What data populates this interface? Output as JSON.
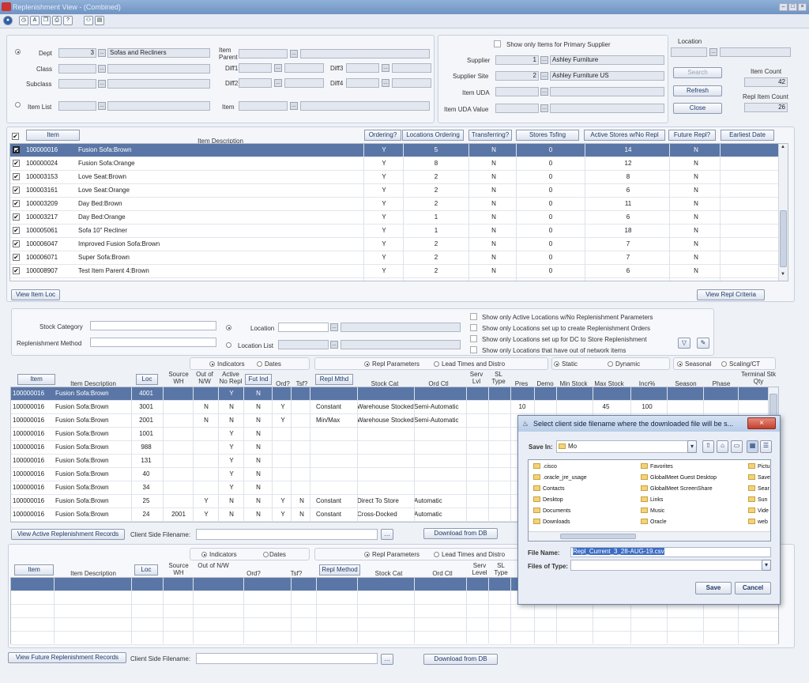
{
  "window": {
    "title": "Replenishment View - (Combined)"
  },
  "filter": {
    "dept_label": "Dept",
    "dept_value": "3",
    "dept_desc": "Sofas and Recliners",
    "class_label": "Class",
    "subclass_label": "Subclass",
    "item_list_label": "Item List",
    "item_parent_label": "Item Parent",
    "diff1_label": "Diff1",
    "diff2_label": "Diff2",
    "diff3_label": "Diff3",
    "diff4_label": "Diff4",
    "item_label": "Item",
    "primary_supplier_label": "Show only Items for Primary Supplier",
    "supplier_label": "Supplier",
    "supplier_value": "1",
    "supplier_desc": "Ashley Furniture",
    "supplier_site_label": "Supplier Site",
    "supplier_site_value": "2",
    "supplier_site_desc": "Ashley Furniture US",
    "item_uda_label": "Item UDA",
    "item_uda_value_label": "Item UDA Value",
    "location_label": "Location",
    "search_btn": "Search",
    "refresh_btn": "Refresh",
    "close_btn": "Close",
    "item_count_label": "Item Count",
    "item_count": "42",
    "repl_item_count_label": "Repl Item Count",
    "repl_item_count": "26"
  },
  "items_grid": {
    "headers": {
      "item": "Item",
      "desc": "Item Description",
      "ordering": "Ordering?",
      "locs_ordering": "Locations Ordering",
      "transferring": "Transferring?",
      "stores_tsfing": "Stores Tsfing",
      "active_stores": "Active Stores w/No Repl",
      "future_repl": "Future Repl?",
      "earliest_date": "Earliest Date"
    },
    "rows": [
      {
        "item": "100000016",
        "desc": "Fusion Sofa:Brown",
        "ordering": "Y",
        "locs": "5",
        "tsf": "N",
        "stores": "0",
        "active": "14",
        "future": "N"
      },
      {
        "item": "100000024",
        "desc": "Fusion Sofa:Orange",
        "ordering": "Y",
        "locs": "8",
        "tsf": "N",
        "stores": "0",
        "active": "12",
        "future": "N"
      },
      {
        "item": "100003153",
        "desc": "Love Seat:Brown",
        "ordering": "Y",
        "locs": "2",
        "tsf": "N",
        "stores": "0",
        "active": "8",
        "future": "N"
      },
      {
        "item": "100003161",
        "desc": "Love Seat:Orange",
        "ordering": "Y",
        "locs": "2",
        "tsf": "N",
        "stores": "0",
        "active": "6",
        "future": "N"
      },
      {
        "item": "100003209",
        "desc": "Day Bed:Brown",
        "ordering": "Y",
        "locs": "2",
        "tsf": "N",
        "stores": "0",
        "active": "11",
        "future": "N"
      },
      {
        "item": "100003217",
        "desc": "Day Bed:Orange",
        "ordering": "Y",
        "locs": "1",
        "tsf": "N",
        "stores": "0",
        "active": "6",
        "future": "N"
      },
      {
        "item": "100005061",
        "desc": "Sofa 10\" Recliner",
        "ordering": "Y",
        "locs": "1",
        "tsf": "N",
        "stores": "0",
        "active": "18",
        "future": "N"
      },
      {
        "item": "100006047",
        "desc": "Improved Fusion Sofa:Brown",
        "ordering": "Y",
        "locs": "2",
        "tsf": "N",
        "stores": "0",
        "active": "7",
        "future": "N"
      },
      {
        "item": "100006071",
        "desc": "Super Sofa:Brown",
        "ordering": "Y",
        "locs": "2",
        "tsf": "N",
        "stores": "0",
        "active": "7",
        "future": "N"
      },
      {
        "item": "100008907",
        "desc": "Test Item Parent 4:Brown",
        "ordering": "Y",
        "locs": "2",
        "tsf": "N",
        "stores": "0",
        "active": "6",
        "future": "N"
      }
    ]
  },
  "view_item_loc_btn": "View Item Loc",
  "view_repl_criteria_btn": "View Repl Criteria",
  "loc_filter": {
    "stock_category_label": "Stock Category",
    "repl_method_label": "Replenishment Method",
    "location_label": "Location",
    "location_list_label": "Location List",
    "opt1": "Show only Active Locations w/No Replenishment Parameters",
    "opt2": "Show only Locations set up to create Replenishment Orders",
    "opt3": "Show only Locations set up for DC to Store Replenishment",
    "opt4": "Show only Locations that have out of network items"
  },
  "active_grid": {
    "radio_indicators": "Indicators",
    "radio_dates": "Dates",
    "radio_repl_params": "Repl Parameters",
    "radio_lead_times": "Lead Times and Distro",
    "radio_static": "Static",
    "radio_dynamic": "Dynamic",
    "radio_seasonal": "Seasonal",
    "radio_scaling": "Scaling/CT",
    "headers": {
      "item": "Item",
      "desc": "Item Description",
      "loc": "Loc",
      "source_wh": "Source WH",
      "out_of_nw": "Out of N/W",
      "active_no_repl": "Active No Repl",
      "fut_ind": "Fut Ind",
      "ord": "Ord?",
      "tsf": "Tsf?",
      "repl_mthd": "Repl Mthd",
      "stock_cat": "Stock Cat",
      "ord_ctl": "Ord Ctl",
      "serv_lvl": "Serv Lvl",
      "sl_type": "SL Type",
      "pres": "Pres",
      "demo": "Demo",
      "min_stock": "Min Stock",
      "max_stock": "Max Stock",
      "incr": "Incr%",
      "season": "Season",
      "phase": "Phase",
      "terminal_stk": "Terminal Stk Qty"
    },
    "rows": [
      {
        "item": "100000016",
        "desc": "Fusion Sofa:Brown",
        "loc": "4001",
        "src": "",
        "onw": "",
        "anr": "Y",
        "fut": "N",
        "ord": "",
        "tsf": "",
        "mthd": "",
        "cat": "",
        "ctl": "",
        "pres": "",
        "max": "",
        "incr": ""
      },
      {
        "item": "100000016",
        "desc": "Fusion Sofa:Brown",
        "loc": "3001",
        "src": "",
        "onw": "N",
        "anr": "N",
        "fut": "N",
        "ord": "Y",
        "tsf": "",
        "mthd": "Constant",
        "cat": "Warehouse Stocked",
        "ctl": "Semi-Automatic",
        "pres": "10",
        "max": "45",
        "incr": "100"
      },
      {
        "item": "100000016",
        "desc": "Fusion Sofa:Brown",
        "loc": "2001",
        "src": "",
        "onw": "N",
        "anr": "N",
        "fut": "N",
        "ord": "Y",
        "tsf": "",
        "mthd": "Min/Max",
        "cat": "Warehouse Stocked",
        "ctl": "Semi-Automatic",
        "pres": "",
        "max": "",
        "incr": ""
      },
      {
        "item": "100000016",
        "desc": "Fusion Sofa:Brown",
        "loc": "1001",
        "src": "",
        "onw": "",
        "anr": "Y",
        "fut": "N",
        "ord": "",
        "tsf": "",
        "mthd": "",
        "cat": "",
        "ctl": "",
        "pres": "",
        "max": "",
        "incr": ""
      },
      {
        "item": "100000016",
        "desc": "Fusion Sofa:Brown",
        "loc": "988",
        "src": "",
        "onw": "",
        "anr": "Y",
        "fut": "N",
        "ord": "",
        "tsf": "",
        "mthd": "",
        "cat": "",
        "ctl": "",
        "pres": "",
        "max": "",
        "incr": ""
      },
      {
        "item": "100000016",
        "desc": "Fusion Sofa:Brown",
        "loc": "131",
        "src": "",
        "onw": "",
        "anr": "Y",
        "fut": "N",
        "ord": "",
        "tsf": "",
        "mthd": "",
        "cat": "",
        "ctl": "",
        "pres": "",
        "max": "",
        "incr": ""
      },
      {
        "item": "100000016",
        "desc": "Fusion Sofa:Brown",
        "loc": "40",
        "src": "",
        "onw": "",
        "anr": "Y",
        "fut": "N",
        "ord": "",
        "tsf": "",
        "mthd": "",
        "cat": "",
        "ctl": "",
        "pres": "",
        "max": "",
        "incr": ""
      },
      {
        "item": "100000016",
        "desc": "Fusion Sofa:Brown",
        "loc": "34",
        "src": "",
        "onw": "",
        "anr": "Y",
        "fut": "N",
        "ord": "",
        "tsf": "",
        "mthd": "",
        "cat": "",
        "ctl": "",
        "pres": "",
        "max": "",
        "incr": ""
      },
      {
        "item": "100000016",
        "desc": "Fusion Sofa:Brown",
        "loc": "25",
        "src": "",
        "onw": "Y",
        "anr": "N",
        "fut": "N",
        "ord": "Y",
        "tsf": "N",
        "mthd": "Constant",
        "cat": "Direct To Store",
        "ctl": "Automatic",
        "pres": "",
        "max": "",
        "incr": ""
      },
      {
        "item": "100000016",
        "desc": "Fusion Sofa:Brown",
        "loc": "24",
        "src": "2001",
        "onw": "Y",
        "anr": "N",
        "fut": "N",
        "ord": "Y",
        "tsf": "N",
        "mthd": "Constant",
        "cat": "Cross-Docked",
        "ctl": "Automatic",
        "pres": "",
        "max": "",
        "incr": ""
      }
    ]
  },
  "view_active_btn": "View Active Replenishment Records",
  "client_filename_label": "Client Side Filename:",
  "download_btn": "Download from DB",
  "future_grid": {
    "radio_indicators": "Indicators",
    "radio_dates": "Dates",
    "radio_repl_params": "Repl Parameters",
    "radio_lead_times": "Lead Times and Distro",
    "headers": {
      "item": "Item",
      "desc": "Item Description",
      "loc": "Loc",
      "source_wh": "Source WH",
      "out_of_nw": "Out of N/W",
      "ord": "Ord?",
      "tsf": "Tsf?",
      "repl_method": "Repl Method",
      "stock_cat": "Stock Cat",
      "ord_ctl": "Ord Ctl",
      "serv_level": "Serv Level",
      "sl_type": "SL Type"
    }
  },
  "view_future_btn": "View Future Replenishment Records",
  "dialog": {
    "title": "Select client side filename where the downloaded file will be s...",
    "save_in_label": "Save In:",
    "save_in_value": "Mo",
    "files": [
      ".cisco",
      ".oracle_jre_usage",
      "Contacts",
      "Desktop",
      "Documents",
      "Downloads",
      "Favorites",
      "GlobalMeet Guest Desktop",
      "GlobalMeet ScreenShare",
      "Links",
      "Music",
      "Oracle",
      "Pictu",
      "Save",
      "Sear",
      "Sun",
      "Vide",
      "web"
    ],
    "file_name_label": "File Name:",
    "file_name_value": "Repl_Current_3_28-AUG-19.csv",
    "files_of_type_label": "Files of Type:",
    "save_btn": "Save",
    "cancel_btn": "Cancel"
  }
}
